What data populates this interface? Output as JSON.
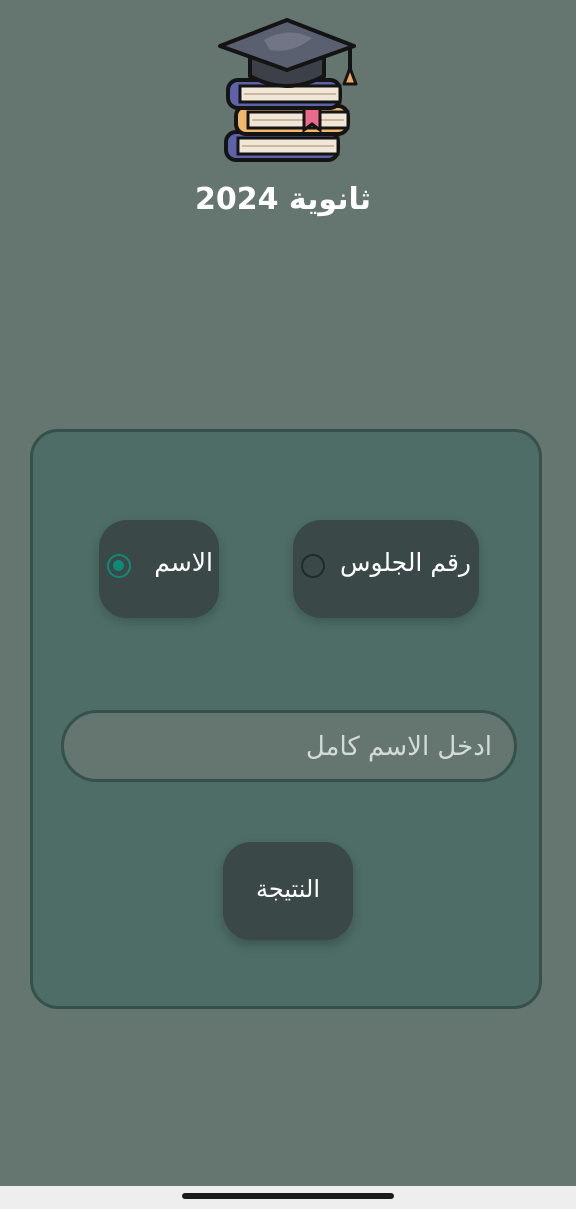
{
  "app": {
    "title": "ثانوية 2024"
  },
  "search_type": {
    "options": [
      {
        "label": "رقم الجلوس",
        "selected": false
      },
      {
        "label": "الاسم",
        "selected": true
      }
    ]
  },
  "search": {
    "value": "",
    "placeholder": "ادخل الاسم كامل"
  },
  "actions": {
    "result_label": "النتيجة"
  },
  "icons": {
    "logo": "graduation-cap-books-icon"
  },
  "colors": {
    "background": "#657671",
    "card": "#4d6d66",
    "button": "#3a4848",
    "radio_selected": "#0e8a77"
  }
}
